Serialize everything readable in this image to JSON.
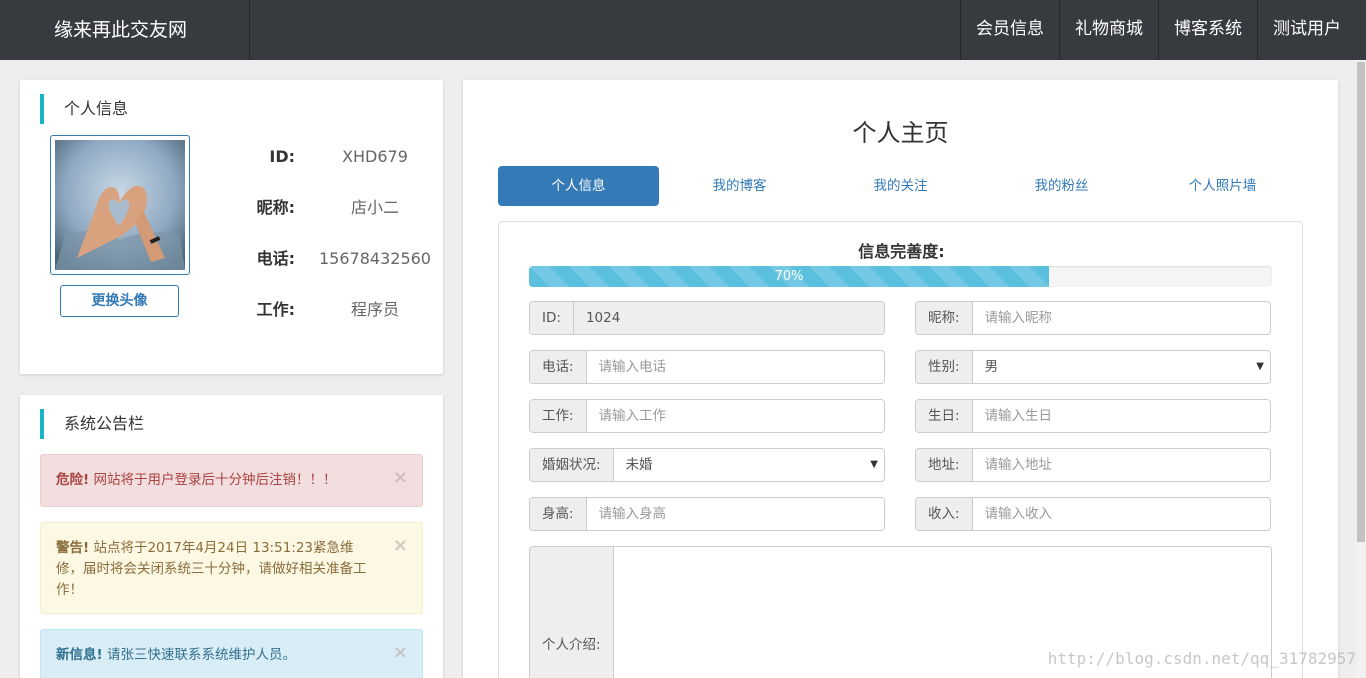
{
  "navbar": {
    "brand": "缘来再此交友网",
    "items": [
      "会员信息",
      "礼物商城",
      "博客系统",
      "测试用户"
    ]
  },
  "profile_panel": {
    "title": "个人信息",
    "change_avatar": "更换头像",
    "fields": [
      {
        "key": "ID:",
        "value": "XHD679"
      },
      {
        "key": "昵称:",
        "value": "店小二"
      },
      {
        "key": "电话:",
        "value": "15678432560"
      },
      {
        "key": "工作:",
        "value": "程序员"
      }
    ]
  },
  "notice_panel": {
    "title": "系统公告栏",
    "alerts": [
      {
        "type": "danger",
        "label": "危险!",
        "text": "网站将于用户登录后十分钟后注销！！！"
      },
      {
        "type": "warning",
        "label": "警告!",
        "text": "站点将于2017年4月24日 13:51:23紧急维修，届时将会关闭系统三十分钟，请做好相关准备工作！"
      },
      {
        "type": "info",
        "label": "新信息!",
        "text": "请张三快速联系系统维护人员。"
      }
    ],
    "close_symbol": "×"
  },
  "main": {
    "title": "个人主页",
    "tabs": [
      "个人信息",
      "我的博客",
      "我的关注",
      "我的粉丝",
      "个人照片墙"
    ],
    "active_tab": 0,
    "progress": {
      "label": "信息完善度:",
      "value_text": "70%",
      "percent": 70
    },
    "form": {
      "id": {
        "label": "ID:",
        "value": "1024"
      },
      "nickname": {
        "label": "昵称:",
        "placeholder": "请输入昵称"
      },
      "phone": {
        "label": "电话:",
        "placeholder": "请输入电话"
      },
      "gender": {
        "label": "性别:",
        "value": "男"
      },
      "job": {
        "label": "工作:",
        "placeholder": "请输入工作"
      },
      "birthday": {
        "label": "生日:",
        "placeholder": "请输入生日"
      },
      "marital": {
        "label": "婚姻状况:",
        "value": "未婚"
      },
      "address": {
        "label": "地址:",
        "placeholder": "请输入地址"
      },
      "height": {
        "label": "身高:",
        "placeholder": "请输入身高"
      },
      "income": {
        "label": "收入:",
        "placeholder": "请输入收入"
      },
      "intro": {
        "label": "个人介绍:"
      }
    }
  },
  "watermark": "http://blog.csdn.net/qq_31782957",
  "colors": {
    "navbar": "#373b3f",
    "accent": "#337ab7",
    "panel_marker": "#17b4c6",
    "progress": "#5bc0de"
  }
}
